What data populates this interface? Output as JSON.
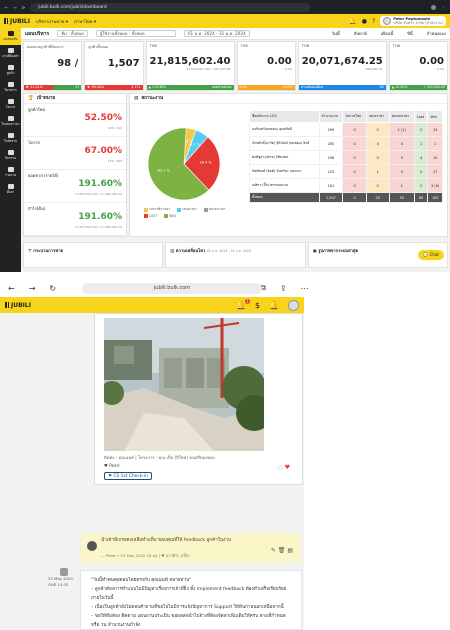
{
  "desktop": {
    "browser_url": "jubili.bulk.com/jubili/dashboard",
    "app": {
      "brand": "JUBILI",
      "menu_dropdown": "บริหารงานขาย",
      "lang_dropdown": "ภาษาไทย",
      "user_name": "Peter Pewlunmain",
      "user_org": "บริษัท จันทร์ฯ จำกัด (สำนักงาน)"
    },
    "sidenav": [
      "แดชบอร์ด",
      "งานที่ต้องทำ",
      "ลูกค้า",
      "โครงการ",
      "โอกาส",
      "ใบเสนอราคา",
      "ใบสั่งขาย",
      "กิจกรรม",
      "รายงาน",
      "ตั้งค่า"
    ],
    "filterbar": {
      "page_title": "แผนบริหาร",
      "sel1": "ทีม : ทั้งหมด",
      "sel2": "ผู้ใช้งานทั้งหมด : ทั้งหมด",
      "date_range": "01 ม.ค. 2024 - 31 ม.ค. 2024",
      "tabs": [
        "วันนี้",
        "สัปดาห์",
        "เดือนนี้",
        "ปีนี้",
        "กำหนดเอง"
      ]
    },
    "kpis": [
      {
        "label": "ยอดขายถูกค้าที่ต้องการ",
        "value": "98 /",
        "sub": "",
        "b1": "▼ -12.41%",
        "b2": "57",
        "c1": "#e53935",
        "c2": "#43a047"
      },
      {
        "label": "ลูกค้าทั้งหมด",
        "value": "1,507",
        "sub": "",
        "b1": "▼ -90.44%",
        "b2": "2,171",
        "c1": "#e53935",
        "c2": "#e53935"
      },
      {
        "label": "THB",
        "value": "21,815,602.40",
        "sub": "12,016,000 (พ.ย.) 185,323.86",
        "b1": "▲ 174.46%",
        "b2": "ยอดขายสะสม 7,451,000.40",
        "c1": "#43a047",
        "c2": "#43a047"
      },
      {
        "label": "THB",
        "value": "0.00",
        "sub": "0.00",
        "b1": "0.00",
        "b2": "0.00%",
        "c1": "#f5a623",
        "c2": "#f5a623"
      },
      {
        "label": "THB",
        "value": "20,071,674.25",
        "sub": "846,082.31",
        "b1": "ค่าเฉลี่ยต่อเดือน",
        "b2": "60",
        "c1": "#1e88e5",
        "c2": "#1e88e5"
      },
      {
        "label": "THB",
        "value": "0.00",
        "sub": "0.00",
        "b1": "▲ 10.00%",
        "b2": "+ 320,000.00",
        "c1": "#43a047",
        "c2": "#43a047"
      }
    ],
    "targets": {
      "title": "เป้าหมาย",
      "rows": [
        {
          "label": "ลูกค้าใหม่",
          "value": "52.50%",
          "sub": "105 / 200",
          "color": "#e53935"
        },
        {
          "label": "โอกาส",
          "value": "67.00%",
          "sub": "134 / 200",
          "color": "#e53935"
        },
        {
          "label": "ยอดขาย (รายได้)",
          "value": "191.60%",
          "sub": "21,815,602.40 / 11,386,000.00",
          "color": "#43a047"
        },
        {
          "label": "กำไร(ต้น)",
          "value": "191.60%",
          "sub": "21,815,602.40 / 11,386,000.00",
          "color": "#43a047"
        }
      ]
    },
    "status": {
      "title": "สถานะงาน",
      "legend": [
        "รอการพิจารณา",
        "เสนอราคา",
        "ต่อรองราคา",
        "LOST",
        "WIN"
      ],
      "legend_colors": [
        "#f2c94c",
        "#56ccf2",
        "#9e9e9e",
        "#e53935",
        "#7cb342"
      ],
      "pie_labels": [
        "26.4 %",
        "6.1 %",
        "5.4 %",
        "63.1 %"
      ],
      "table_headers": [
        "ชื่อพนักงาน (20)",
        "จำนวนงาน",
        "โอกาสใหม่",
        "เสนอราคา",
        "ต่อรองราคา",
        "Lost",
        "Win"
      ],
      "rows": [
        [
          "นครินทร์(ทดสอบ) ยุทธศิลป์",
          "299",
          "0",
          "0",
          "1 (1)",
          "2",
          "13"
        ],
        [
          "ภัทรศักดิ์(อาร์ต) ฐิติวัฒน์ (ทดสอบ) สิงห์",
          "285",
          "0",
          "4",
          "0",
          "1",
          "1"
        ],
        [
          "พงศ์ชูตา(เฟรช) กิติมงคล",
          "298",
          "0",
          "0",
          "0",
          "4",
          "15"
        ],
        [
          "จิตต์พนต์ (จิตต์) จันทร์มะ นครเตะ",
          "223",
          "0",
          "1",
          "0",
          "0",
          "17"
        ],
        [
          "ณศิกร (บิ๊ก) พรรณพนาม",
          "161",
          "0",
          "0",
          "1",
          "2",
          "3 (0)"
        ]
      ],
      "totals": [
        "ทั้งหมด",
        "1,507",
        "0",
        "29",
        "50",
        "80",
        "105"
      ]
    },
    "bottom_panels": [
      "กระบวนการขาย",
      "ความเคลื่อนไหว",
      "รูปภาพจากระบบล่าสุด"
    ],
    "bottom_date": "01 ม.ค. 2024 - 31 ม.ค. 2024",
    "chat_label": "Chat"
  },
  "mobile": {
    "url": "jubili.bulk.com",
    "brand": "JUBILI",
    "notif_count": "1",
    "post1": {
      "caption": "ติดต่อ : คุณนนท์ | โครงการ : คุณ เปิ้ล (ปีใหม่) ดนตรีทองทอง",
      "likes": "♥ Pearl",
      "badge": "CS 1st Check-in"
    },
    "comment": {
      "text": "นำเข้าทีเกรยคงเหลือทำแท็บ ขอบคุณที่ให้ feedback ลูกค้าในงาน",
      "meta": "— Peter • 23 May 2020 20:44 | ♥ นวาทิวา (เปิ้ล)"
    },
    "post2": {
      "date": "23 May 2020",
      "id": "GHS 10.03",
      "lines": [
        "\"วันนี้ทำคนคุยตอบโดยตรงกับ คุณนนท์ หลายท่าน\"",
        "– ลูกค้าต้องการทำแบบไม่มีปัญหาเรื่องการเจ้าที่ยิ่ง ทั้ง implement feedback ต้องทำเสร็จเรียบร้อย",
        "ภายในวันนี้",
        "– เนื่องในลูกค้ายังไม่ตอบคำถามที่ขอไปไม่มีการแจ้งปัญหาการ Support ให้ทันกาลนอกเหนือจากนี้",
        "– ขอให้ทีมต้อง ติดตาม แผนงานประเมิน ขอผลลพนำไปจ้างที่ต้องจัดหาเพิ่มเติมให้ครบ ตามที่กำหนด",
        "หรือ วน จำนวนงานกำลัง"
      ]
    }
  }
}
